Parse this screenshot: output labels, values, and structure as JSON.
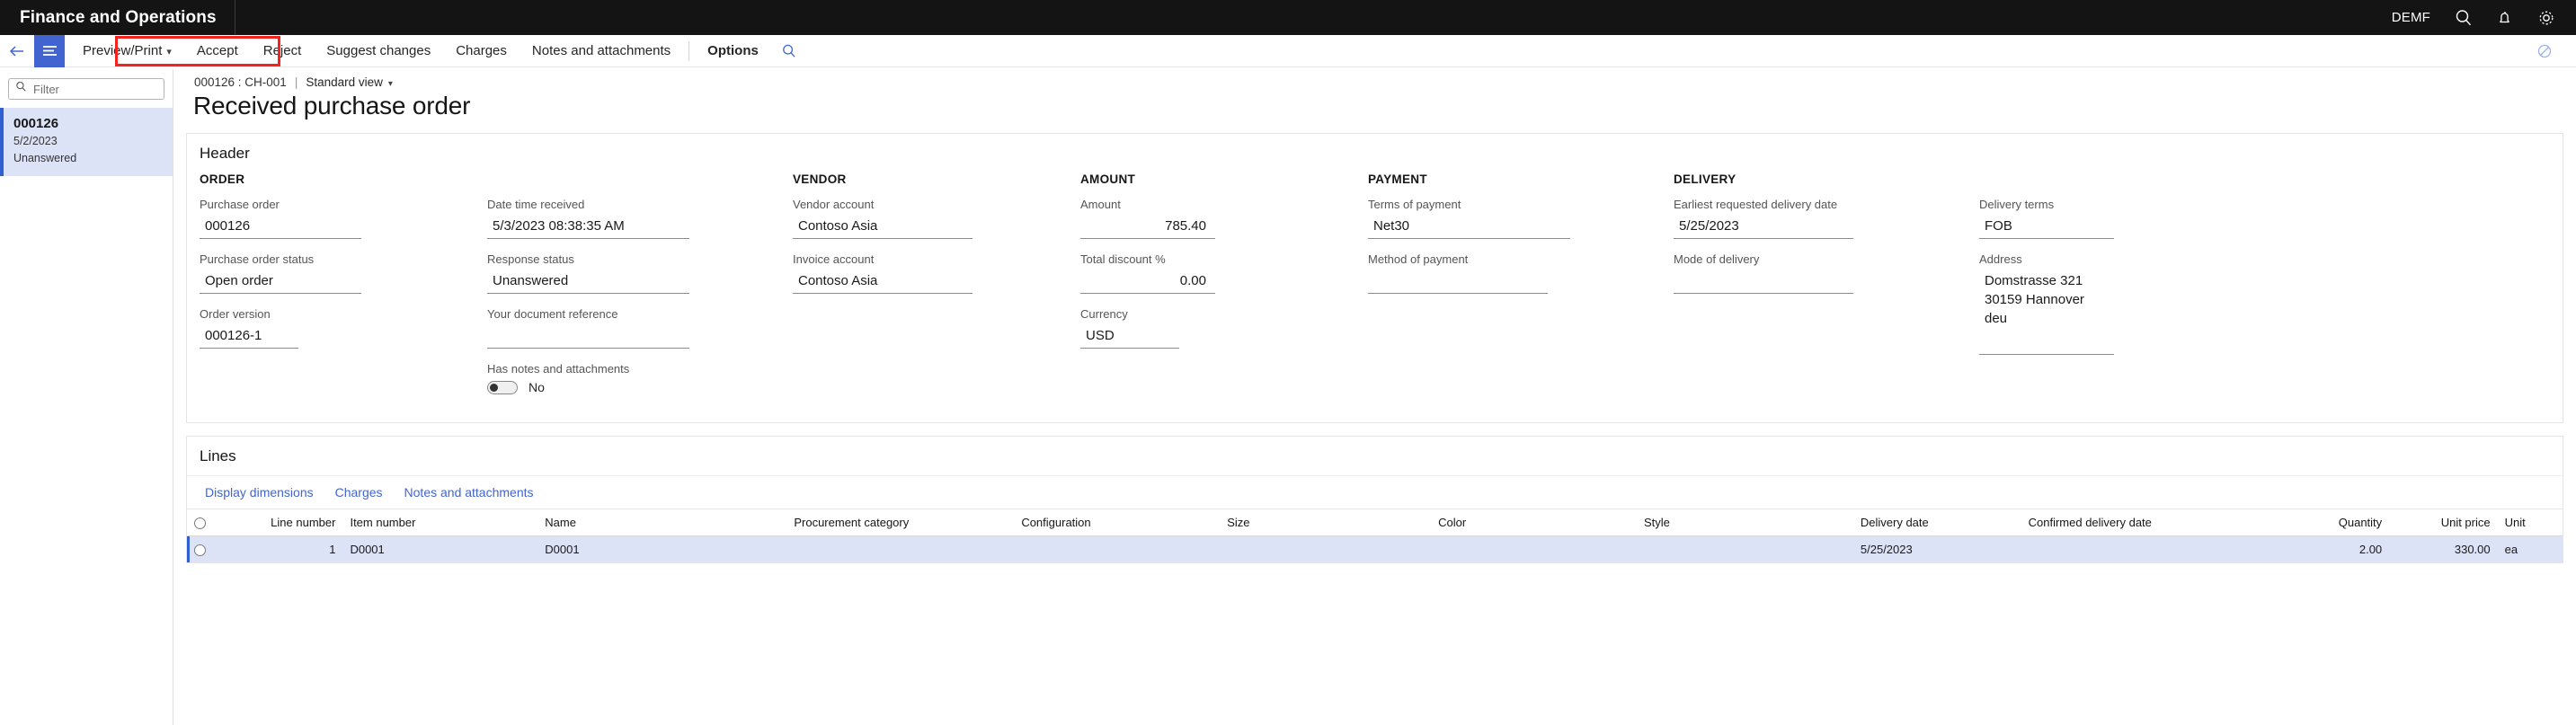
{
  "topbar": {
    "brand": "Finance and Operations",
    "company": "DEMF",
    "search_icon": "search-icon",
    "notification_icon": "bell-icon",
    "settings_icon": "gear-icon"
  },
  "toolbar": {
    "back_icon": "back-arrow-icon",
    "menu_icon": "hamburger-icon",
    "preview_print": "Preview/Print",
    "accept": "Accept",
    "reject": "Reject",
    "suggest_changes": "Suggest changes",
    "charges": "Charges",
    "notes_and_attachments": "Notes and attachments",
    "options": "Options",
    "search_icon": "search-icon",
    "right_icon": "attachment-icon",
    "highlight_color": "#f3231f"
  },
  "left_panel": {
    "filter_placeholder": "Filter",
    "filter_value": "",
    "items": [
      {
        "title": "000126",
        "date": "5/2/2023",
        "status": "Unanswered",
        "selected": true
      }
    ]
  },
  "breadcrumb": {
    "record": "000126 : CH-001",
    "separator": "|",
    "view": "Standard view"
  },
  "page_title": "Received purchase order",
  "header_section": {
    "title": "Header",
    "groups": {
      "order": {
        "label": "ORDER",
        "fields": [
          {
            "label": "Purchase order",
            "value": "000126"
          },
          {
            "label": "Purchase order status",
            "value": "Open order"
          },
          {
            "label": "Order version",
            "value": "000126-1"
          }
        ]
      },
      "datetime": {
        "label": "",
        "fields": [
          {
            "label": "Date time received",
            "value": "5/3/2023 08:38:35 AM"
          },
          {
            "label": "Response status",
            "value": "Unanswered"
          },
          {
            "label": "Your document reference",
            "value": ""
          },
          {
            "label": "Has notes and attachments",
            "value": "No"
          }
        ]
      },
      "vendor": {
        "label": "VENDOR",
        "fields": [
          {
            "label": "Vendor account",
            "value": "Contoso Asia"
          },
          {
            "label": "Invoice account",
            "value": "Contoso Asia"
          }
        ]
      },
      "amount": {
        "label": "AMOUNT",
        "fields": [
          {
            "label": "Amount",
            "value": "785.40"
          },
          {
            "label": "Total discount %",
            "value": "0.00"
          },
          {
            "label": "Currency",
            "value": "USD"
          }
        ]
      },
      "payment": {
        "label": "PAYMENT",
        "fields": [
          {
            "label": "Terms of payment",
            "value": "Net30"
          },
          {
            "label": "Method of payment",
            "value": ""
          }
        ]
      },
      "delivery": {
        "label": "DELIVERY",
        "fields": [
          {
            "label": "Earliest requested delivery date",
            "value": "5/25/2023"
          },
          {
            "label": "Mode of delivery",
            "value": ""
          }
        ]
      },
      "terms": {
        "label": "",
        "fields": [
          {
            "label": "Delivery terms",
            "value": "FOB"
          },
          {
            "label": "Address",
            "value": "Domstrasse 321\n30159 Hannover\ndeu"
          }
        ]
      }
    }
  },
  "lines_section": {
    "title": "Lines",
    "tabs": [
      {
        "label": "Display dimensions"
      },
      {
        "label": "Charges"
      },
      {
        "label": "Notes and attachments"
      }
    ],
    "table": {
      "columns": [
        "Line number",
        "Item number",
        "Name",
        "Procurement category",
        "Configuration",
        "Size",
        "Color",
        "Style",
        "Delivery date",
        "Confirmed delivery date",
        "Quantity",
        "Unit price",
        "Unit"
      ],
      "rows": [
        {
          "selected": true,
          "line_number": "1",
          "item_number": "D0001",
          "name": "D0001",
          "procurement_category": "",
          "configuration": "",
          "size": "",
          "color": "",
          "style": "",
          "delivery_date": "5/25/2023",
          "confirmed_delivery_date": "",
          "quantity": "2.00",
          "unit_price": "330.00",
          "unit": "ea"
        }
      ]
    }
  }
}
